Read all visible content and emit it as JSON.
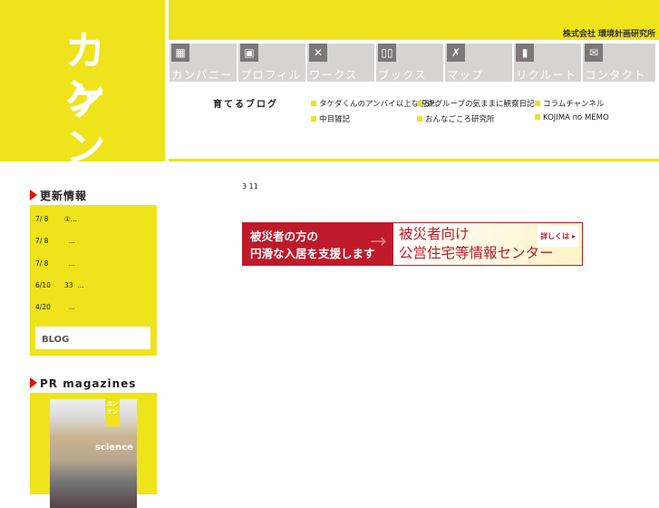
{
  "logo": {
    "line1": "カン",
    "line2": "ケン"
  },
  "header": {
    "company": "株式会社 環境計画研究所"
  },
  "nav": [
    {
      "label": "カンパニー",
      "icon": "building-icon",
      "glyph": "▦"
    },
    {
      "label": "プロフィル",
      "icon": "profile-icon",
      "glyph": "▣"
    },
    {
      "label": "ワークス",
      "icon": "tools-icon",
      "glyph": "✕"
    },
    {
      "label": "ブックス",
      "icon": "book-icon",
      "glyph": "▯▯"
    },
    {
      "label": "マップ",
      "icon": "map-icon",
      "glyph": "✗"
    },
    {
      "label": "リクルート",
      "icon": "tie-icon",
      "glyph": "▮"
    },
    {
      "label": "コンタクト",
      "icon": "mail-icon",
      "glyph": "✉"
    }
  ],
  "blogs": {
    "title": "育てるブログ",
    "items": [
      "タケダくんのアンバイ以上な視点。",
      "SPグループの気ままに観察日記",
      "コラムチャンネル",
      "中目雑記",
      "おんなごころ研究所",
      "KOJIMA no MEMO"
    ]
  },
  "sidebar": {
    "news_title": "更新情報",
    "news": [
      {
        "date": "7/ 8",
        "text": "①..."
      },
      {
        "date": "7/ 8",
        "text": "  ..."
      },
      {
        "date": "7/ 8",
        "text": "  ..."
      },
      {
        "date": "6/10",
        "text": "33  ..."
      },
      {
        "date": "4/20",
        "text": "  ..."
      }
    ],
    "blog_button": "BLOG",
    "pr_title": "PR magazines",
    "mag_badge": "カンケン",
    "mag_title": "science"
  },
  "main": {
    "heading": "3 11",
    "banner": {
      "left1": "被災者の方の",
      "left2": "円滑な入居を支援します",
      "right1": "被災者向け",
      "right2": "公営住宅等情報センター",
      "more": "詳しくは ▸"
    }
  }
}
